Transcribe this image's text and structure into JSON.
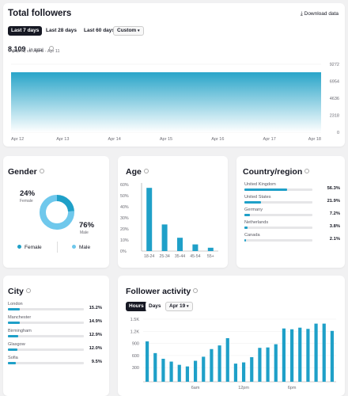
{
  "colors": {
    "accent": "#1fa0c8",
    "male": "#6fc8ec",
    "female": "#1fa0c8",
    "text": "#161823",
    "muted": "#6b6b73"
  },
  "total_followers": {
    "title": "Total followers",
    "download_label": "Download data",
    "tabs": [
      {
        "label": "Last 7 days",
        "active": true
      },
      {
        "label": "Last 28 days",
        "active": false
      },
      {
        "label": "Last 60 days",
        "active": false
      },
      {
        "label": "Custom",
        "active": false
      }
    ],
    "total_value": "8,109",
    "total_suffix": "in total",
    "change_text": "-3 (0%) vs. Apr 5 - Apr 11",
    "chart_data": {
      "type": "area",
      "x": [
        "Apr 12",
        "Apr 13",
        "Apr 14",
        "Apr 15",
        "Apr 16",
        "Apr 17",
        "Apr 18"
      ],
      "values": [
        8109,
        8109,
        8109,
        8109,
        8109,
        8109,
        8109
      ],
      "yticks": [
        "9272",
        "6954",
        "4636",
        "2318",
        "0"
      ],
      "ylim": [
        0,
        9272
      ]
    }
  },
  "gender": {
    "title": "Gender",
    "female_pct": "24%",
    "female_label": "Female",
    "male_pct": "76%",
    "male_label": "Male",
    "legend_female": "Female",
    "legend_male": "Male",
    "chart_data": {
      "type": "pie",
      "categories": [
        "Female",
        "Male"
      ],
      "values": [
        24,
        76
      ]
    }
  },
  "age": {
    "title": "Age",
    "chart_data": {
      "type": "bar",
      "categories": [
        "18-24",
        "25-34",
        "35-44",
        "45-54",
        "55+"
      ],
      "values": [
        57,
        24,
        12,
        6,
        3
      ],
      "yticks": [
        "60%",
        "50%",
        "40%",
        "30%",
        "20%",
        "10%",
        "0%"
      ],
      "ylim": [
        0,
        60
      ]
    }
  },
  "country": {
    "title": "Country/region",
    "rows": [
      {
        "label": "United Kingdom",
        "value": "56.3%",
        "pct": 56.3
      },
      {
        "label": "United States",
        "value": "21.9%",
        "pct": 21.9
      },
      {
        "label": "Germany",
        "value": "7.2%",
        "pct": 7.2
      },
      {
        "label": "Netherlands",
        "value": "3.8%",
        "pct": 3.8
      },
      {
        "label": "Canada",
        "value": "2.1%",
        "pct": 2.1
      }
    ]
  },
  "city": {
    "title": "City",
    "rows": [
      {
        "label": "London",
        "value": "15.2%",
        "pct": 15.2
      },
      {
        "label": "Manchester",
        "value": "14.9%",
        "pct": 14.9
      },
      {
        "label": "Birmingham",
        "value": "12.9%",
        "pct": 12.9
      },
      {
        "label": "Glasgow",
        "value": "12.0%",
        "pct": 12.0
      },
      {
        "label": "Sofia",
        "value": "9.5%",
        "pct": 9.5
      }
    ]
  },
  "activity": {
    "title": "Follower activity",
    "tabs": [
      {
        "label": "Hours",
        "active": true
      },
      {
        "label": "Days",
        "active": false
      }
    ],
    "date_label": "Apr 19",
    "chart_data": {
      "type": "bar",
      "x": [
        "0",
        "1",
        "2",
        "3",
        "4",
        "5",
        "6",
        "7",
        "8",
        "9",
        "10",
        "11",
        "12",
        "13",
        "14",
        "15",
        "16",
        "17",
        "18",
        "19",
        "20",
        "21",
        "22",
        "23"
      ],
      "values": [
        950,
        660,
        520,
        450,
        370,
        330,
        470,
        570,
        760,
        850,
        1030,
        400,
        430,
        560,
        790,
        800,
        880,
        1270,
        1250,
        1290,
        1260,
        1390,
        1390,
        1210
      ],
      "yticks": [
        "1.5K",
        "1.2K",
        "900",
        "600",
        "300"
      ],
      "ylim": [
        0,
        1500
      ],
      "xticks": [
        "6am",
        "12pm",
        "6pm"
      ]
    }
  }
}
